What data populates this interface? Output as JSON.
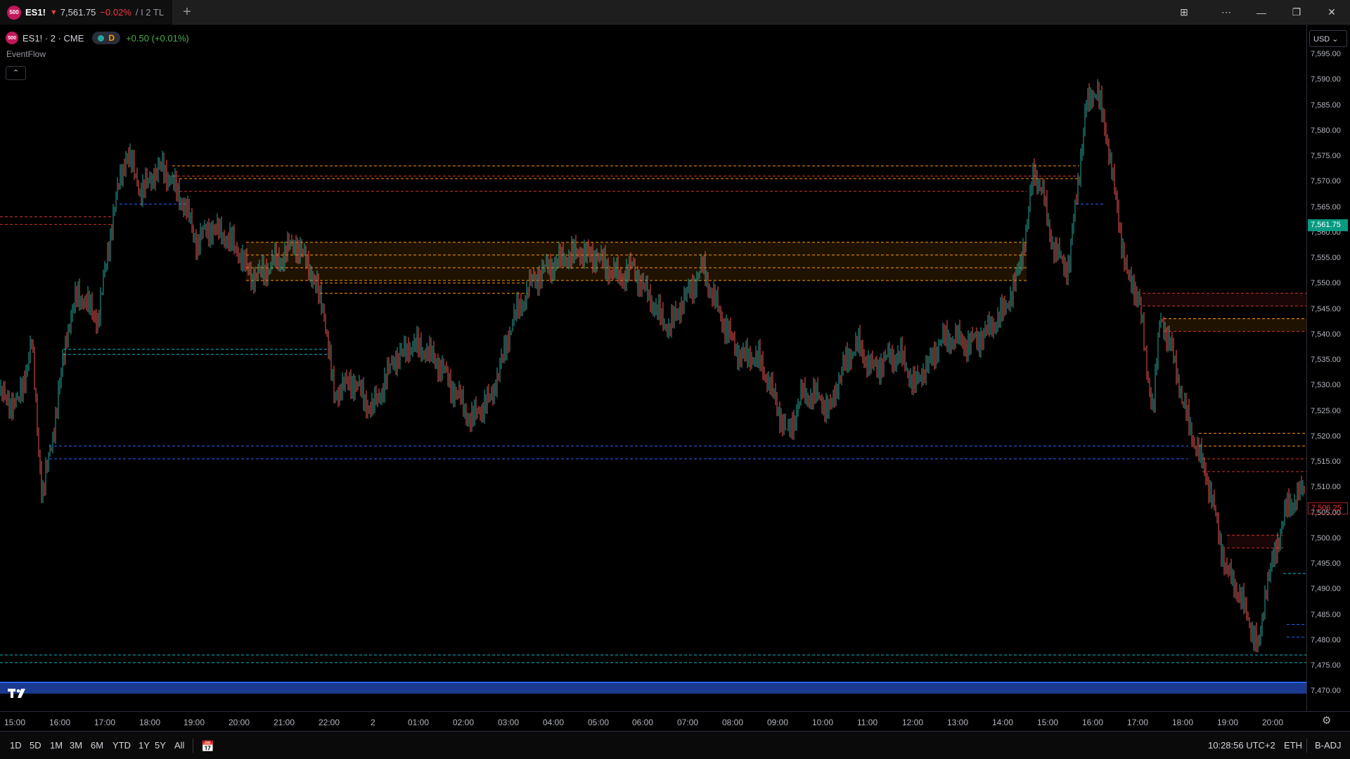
{
  "tab": {
    "logo": "500",
    "symbol": "ES1!",
    "arrow": "▼",
    "price": "7,561.75",
    "change": "−0.02%",
    "rest": "/ I 2 TL"
  },
  "newtab_label": "+",
  "window": {
    "layout_icon": "⊞",
    "more_icon": "⋯",
    "minimize": "—",
    "restore": "❐",
    "close": "✕"
  },
  "legend": {
    "logo": "500",
    "symbol": "ES1! · 2 · CME",
    "pill_label": "D",
    "change": "+0.50 (+0.01%)"
  },
  "indicator": "EventFlow",
  "collapse_label": "⌃",
  "currency": "USD ⌄",
  "price_axis": [
    "7,595.00",
    "7,590.00",
    "7,585.00",
    "7,580.00",
    "7,575.00",
    "7,570.00",
    "7,565.00",
    "7,560.00",
    "7,555.00",
    "7,550.00",
    "7,545.00",
    "7,540.00",
    "7,535.00",
    "7,530.00",
    "7,525.00",
    "7,520.00",
    "7,515.00",
    "7,510.00",
    "7,505.00",
    "7,500.00",
    "7,495.00",
    "7,490.00",
    "7,485.00",
    "7,480.00",
    "7,475.00",
    "7,470.00"
  ],
  "current_price_label": "7,561.75",
  "alt_price_label": "7,506.25",
  "time_axis": [
    "15:00",
    "16:00",
    "17:00",
    "18:00",
    "19:00",
    "20:00",
    "21:00",
    "22:00",
    "2",
    "01:00",
    "02:00",
    "03:00",
    "04:00",
    "05:00",
    "06:00",
    "07:00",
    "08:00",
    "09:00",
    "10:00",
    "11:00",
    "12:00",
    "13:00",
    "14:00",
    "15:00",
    "16:00",
    "17:00",
    "18:00",
    "19:00",
    "20:00"
  ],
  "ranges": [
    "1D",
    "5D",
    "1M",
    "3M",
    "6M",
    "YTD",
    "1Y",
    "5Y",
    "All"
  ],
  "bottom_right": {
    "time": "10:28:56 UTC+2",
    "session": "ETH",
    "adj": "B-ADJ"
  },
  "colors": {
    "up": "#26a69a",
    "down": "#ef5350",
    "orange": "#ff9800",
    "red_zone": "#d32f2f",
    "blue_zone": "#2962ff",
    "cyan_zone": "#00bcd4",
    "band": "#1e3a8a"
  }
}
